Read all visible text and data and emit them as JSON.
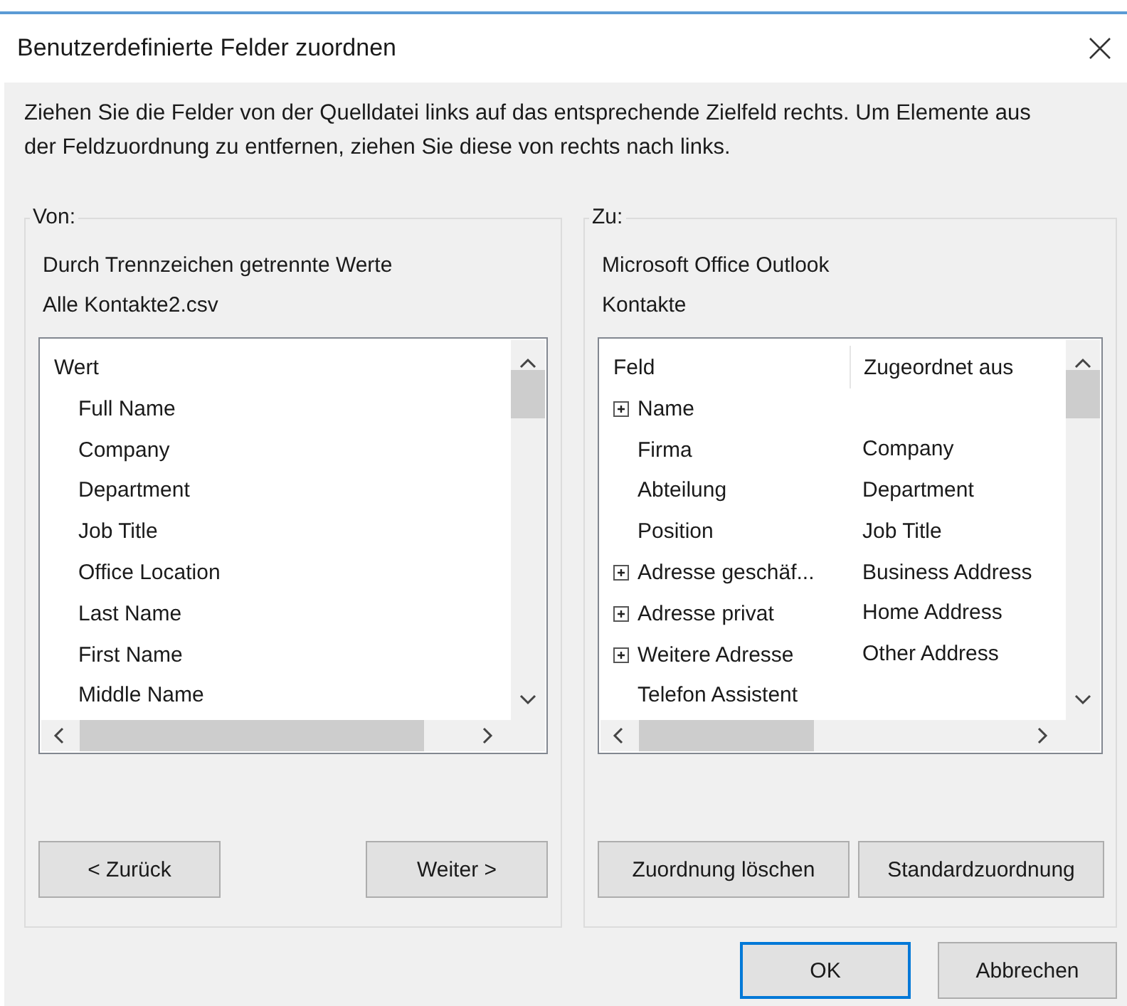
{
  "window": {
    "title": "Benutzerdefinierte Felder zuordnen"
  },
  "instructions": "Ziehen Sie die Felder von der Quelldatei links auf das entsprechende Zielfeld rechts. Um Elemente aus der Feldzuordnung zu entfernen, ziehen Sie diese von rechts nach links.",
  "source": {
    "legend": "Von:",
    "format": "Durch Trennzeichen getrennte Werte",
    "file": "Alle Kontakte2.csv",
    "list": {
      "columns": [
        "Wert"
      ],
      "rows": [
        {
          "cells": [
            "Full Name"
          ],
          "expandable": false
        },
        {
          "cells": [
            "Company"
          ],
          "expandable": false
        },
        {
          "cells": [
            "Department"
          ],
          "expandable": false
        },
        {
          "cells": [
            "Job Title"
          ],
          "expandable": false
        },
        {
          "cells": [
            "Office Location"
          ],
          "expandable": false
        },
        {
          "cells": [
            "Last Name"
          ],
          "expandable": false
        },
        {
          "cells": [
            "First Name"
          ],
          "expandable": false
        },
        {
          "cells": [
            "Middle Name"
          ],
          "expandable": false
        }
      ]
    },
    "buttons": [
      "< Zurück",
      "Weiter >"
    ]
  },
  "target": {
    "legend": "Zu:",
    "application": "Microsoft Office Outlook",
    "folder": "Kontakte",
    "list": {
      "columns": [
        "Feld",
        "Zugeordnet aus"
      ],
      "rows": [
        {
          "cells": [
            "Name"
          ],
          "expandable": true
        },
        {
          "cells": [
            "Firma",
            "Company"
          ],
          "expandable": false
        },
        {
          "cells": [
            "Abteilung",
            "Department"
          ],
          "expandable": false
        },
        {
          "cells": [
            "Position",
            "Job Title"
          ],
          "expandable": false
        },
        {
          "cells": [
            "Adresse geschäf...",
            "Business Address"
          ],
          "expandable": true
        },
        {
          "cells": [
            "Adresse privat",
            "Home Address"
          ],
          "expandable": true
        },
        {
          "cells": [
            "Weitere Adresse",
            "Other Address"
          ],
          "expandable": true
        },
        {
          "cells": [
            "Telefon Assistent"
          ],
          "expandable": false
        }
      ]
    },
    "buttons": [
      "Zuordnung löschen",
      "Standardzuordnung"
    ]
  },
  "dialog_buttons": [
    {
      "label": "OK",
      "default": true
    },
    {
      "label": "Abbrechen",
      "default": false
    }
  ]
}
